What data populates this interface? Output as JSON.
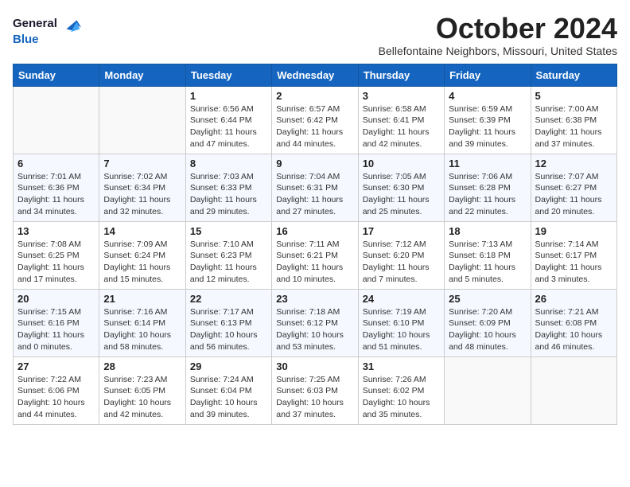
{
  "header": {
    "logo_line1": "General",
    "logo_line2": "Blue",
    "month_title": "October 2024",
    "subtitle": "Bellefontaine Neighbors, Missouri, United States"
  },
  "weekdays": [
    "Sunday",
    "Monday",
    "Tuesday",
    "Wednesday",
    "Thursday",
    "Friday",
    "Saturday"
  ],
  "weeks": [
    [
      {
        "day": "",
        "info": ""
      },
      {
        "day": "",
        "info": ""
      },
      {
        "day": "1",
        "info": "Sunrise: 6:56 AM\nSunset: 6:44 PM\nDaylight: 11 hours and 47 minutes."
      },
      {
        "day": "2",
        "info": "Sunrise: 6:57 AM\nSunset: 6:42 PM\nDaylight: 11 hours and 44 minutes."
      },
      {
        "day": "3",
        "info": "Sunrise: 6:58 AM\nSunset: 6:41 PM\nDaylight: 11 hours and 42 minutes."
      },
      {
        "day": "4",
        "info": "Sunrise: 6:59 AM\nSunset: 6:39 PM\nDaylight: 11 hours and 39 minutes."
      },
      {
        "day": "5",
        "info": "Sunrise: 7:00 AM\nSunset: 6:38 PM\nDaylight: 11 hours and 37 minutes."
      }
    ],
    [
      {
        "day": "6",
        "info": "Sunrise: 7:01 AM\nSunset: 6:36 PM\nDaylight: 11 hours and 34 minutes."
      },
      {
        "day": "7",
        "info": "Sunrise: 7:02 AM\nSunset: 6:34 PM\nDaylight: 11 hours and 32 minutes."
      },
      {
        "day": "8",
        "info": "Sunrise: 7:03 AM\nSunset: 6:33 PM\nDaylight: 11 hours and 29 minutes."
      },
      {
        "day": "9",
        "info": "Sunrise: 7:04 AM\nSunset: 6:31 PM\nDaylight: 11 hours and 27 minutes."
      },
      {
        "day": "10",
        "info": "Sunrise: 7:05 AM\nSunset: 6:30 PM\nDaylight: 11 hours and 25 minutes."
      },
      {
        "day": "11",
        "info": "Sunrise: 7:06 AM\nSunset: 6:28 PM\nDaylight: 11 hours and 22 minutes."
      },
      {
        "day": "12",
        "info": "Sunrise: 7:07 AM\nSunset: 6:27 PM\nDaylight: 11 hours and 20 minutes."
      }
    ],
    [
      {
        "day": "13",
        "info": "Sunrise: 7:08 AM\nSunset: 6:25 PM\nDaylight: 11 hours and 17 minutes."
      },
      {
        "day": "14",
        "info": "Sunrise: 7:09 AM\nSunset: 6:24 PM\nDaylight: 11 hours and 15 minutes."
      },
      {
        "day": "15",
        "info": "Sunrise: 7:10 AM\nSunset: 6:23 PM\nDaylight: 11 hours and 12 minutes."
      },
      {
        "day": "16",
        "info": "Sunrise: 7:11 AM\nSunset: 6:21 PM\nDaylight: 11 hours and 10 minutes."
      },
      {
        "day": "17",
        "info": "Sunrise: 7:12 AM\nSunset: 6:20 PM\nDaylight: 11 hours and 7 minutes."
      },
      {
        "day": "18",
        "info": "Sunrise: 7:13 AM\nSunset: 6:18 PM\nDaylight: 11 hours and 5 minutes."
      },
      {
        "day": "19",
        "info": "Sunrise: 7:14 AM\nSunset: 6:17 PM\nDaylight: 11 hours and 3 minutes."
      }
    ],
    [
      {
        "day": "20",
        "info": "Sunrise: 7:15 AM\nSunset: 6:16 PM\nDaylight: 11 hours and 0 minutes."
      },
      {
        "day": "21",
        "info": "Sunrise: 7:16 AM\nSunset: 6:14 PM\nDaylight: 10 hours and 58 minutes."
      },
      {
        "day": "22",
        "info": "Sunrise: 7:17 AM\nSunset: 6:13 PM\nDaylight: 10 hours and 56 minutes."
      },
      {
        "day": "23",
        "info": "Sunrise: 7:18 AM\nSunset: 6:12 PM\nDaylight: 10 hours and 53 minutes."
      },
      {
        "day": "24",
        "info": "Sunrise: 7:19 AM\nSunset: 6:10 PM\nDaylight: 10 hours and 51 minutes."
      },
      {
        "day": "25",
        "info": "Sunrise: 7:20 AM\nSunset: 6:09 PM\nDaylight: 10 hours and 48 minutes."
      },
      {
        "day": "26",
        "info": "Sunrise: 7:21 AM\nSunset: 6:08 PM\nDaylight: 10 hours and 46 minutes."
      }
    ],
    [
      {
        "day": "27",
        "info": "Sunrise: 7:22 AM\nSunset: 6:06 PM\nDaylight: 10 hours and 44 minutes."
      },
      {
        "day": "28",
        "info": "Sunrise: 7:23 AM\nSunset: 6:05 PM\nDaylight: 10 hours and 42 minutes."
      },
      {
        "day": "29",
        "info": "Sunrise: 7:24 AM\nSunset: 6:04 PM\nDaylight: 10 hours and 39 minutes."
      },
      {
        "day": "30",
        "info": "Sunrise: 7:25 AM\nSunset: 6:03 PM\nDaylight: 10 hours and 37 minutes."
      },
      {
        "day": "31",
        "info": "Sunrise: 7:26 AM\nSunset: 6:02 PM\nDaylight: 10 hours and 35 minutes."
      },
      {
        "day": "",
        "info": ""
      },
      {
        "day": "",
        "info": ""
      }
    ]
  ]
}
